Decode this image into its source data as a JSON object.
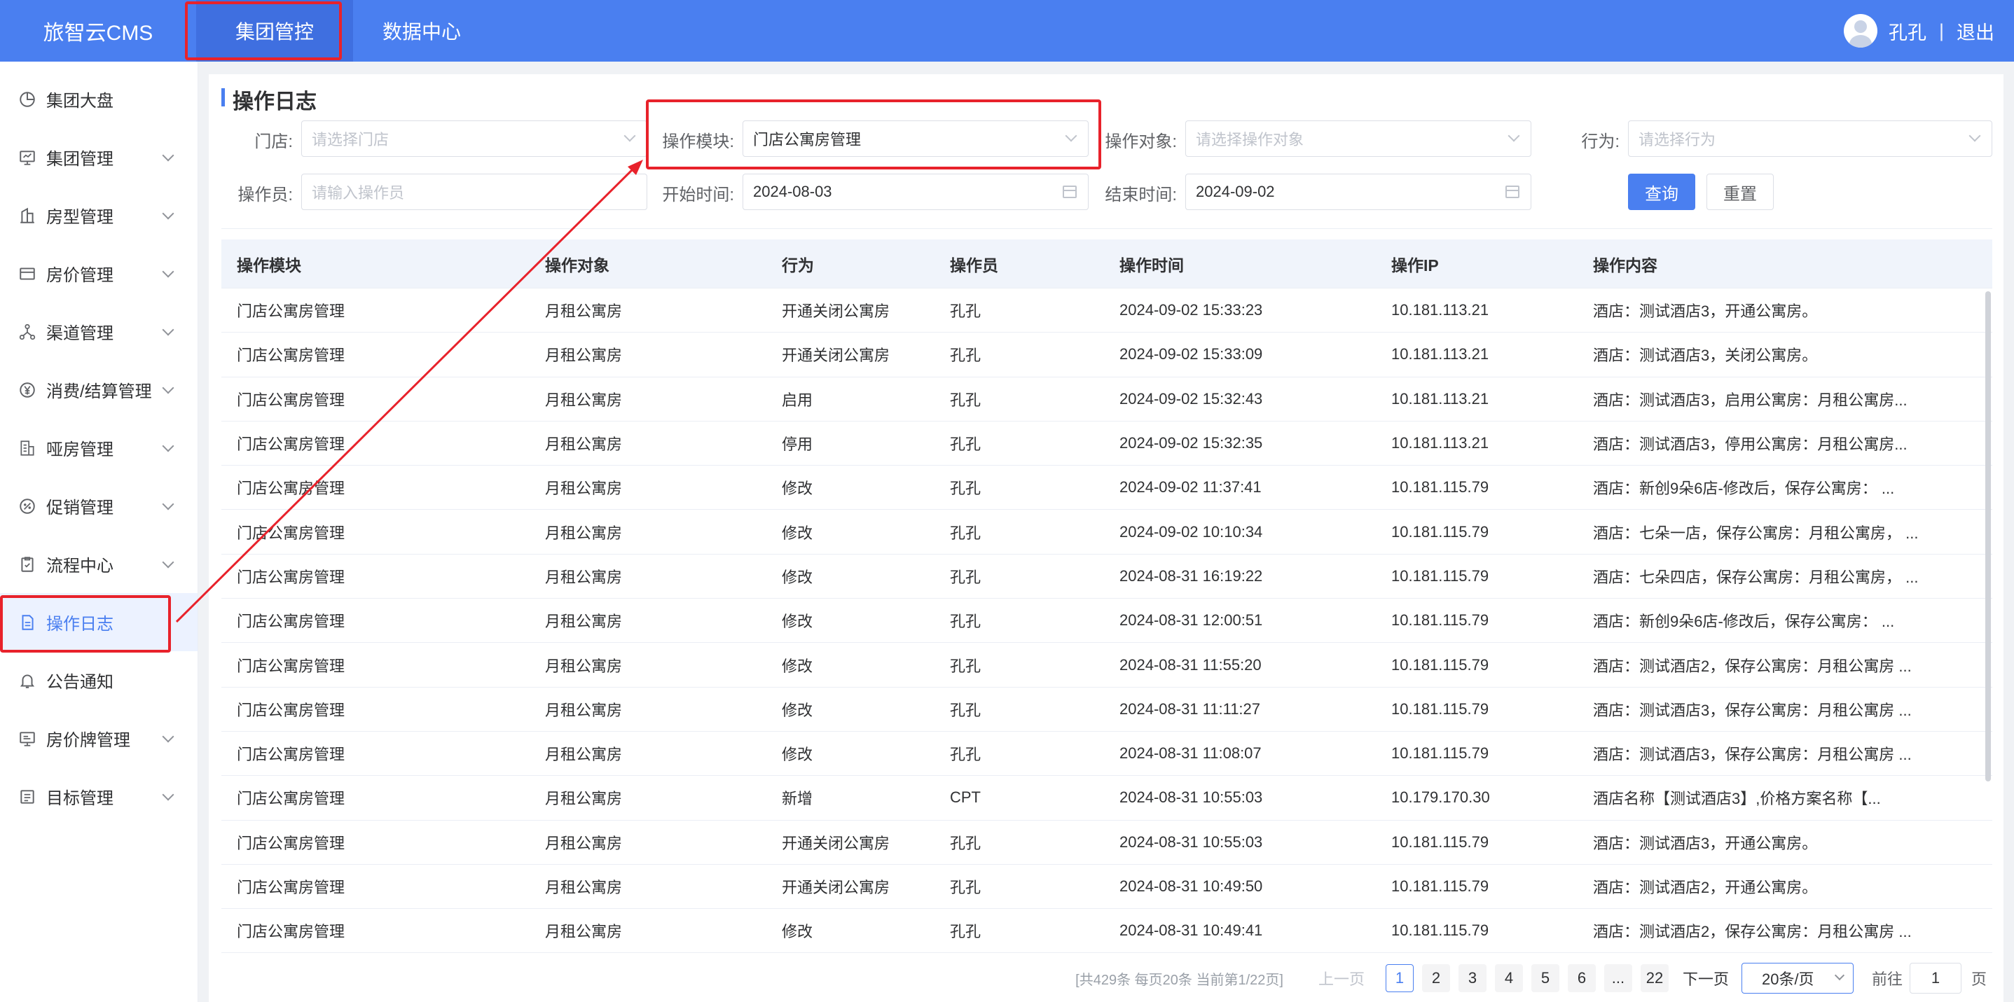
{
  "header": {
    "brand": "旅智云CMS",
    "nav": [
      "集团管控",
      "数据中心"
    ],
    "user": "孔孔",
    "separator": "|",
    "logout": "退出"
  },
  "sidebar": {
    "items": [
      {
        "label": "集团大盘",
        "icon": "pie-chart-icon"
      },
      {
        "label": "集团管理",
        "icon": "monitor-icon"
      },
      {
        "label": "房型管理",
        "icon": "building-icon"
      },
      {
        "label": "房价管理",
        "icon": "card-icon"
      },
      {
        "label": "渠道管理",
        "icon": "network-icon"
      },
      {
        "label": "消费/结算管理",
        "icon": "yen-icon"
      },
      {
        "label": "哑房管理",
        "icon": "room-icon"
      },
      {
        "label": "促销管理",
        "icon": "promotion-icon"
      },
      {
        "label": "流程中心",
        "icon": "clipboard-icon"
      },
      {
        "label": "操作日志",
        "icon": "document-icon"
      },
      {
        "label": "公告通知",
        "icon": "bell-icon"
      },
      {
        "label": "房价牌管理",
        "icon": "board-icon"
      },
      {
        "label": "目标管理",
        "icon": "target-icon"
      }
    ]
  },
  "page": {
    "title": "操作日志"
  },
  "filters": {
    "store_label": "门店:",
    "store_placeholder": "请选择门店",
    "module_label": "操作模块:",
    "module_value": "门店公寓房管理",
    "object_label": "操作对象:",
    "object_placeholder": "请选择操作对象",
    "action_label": "行为:",
    "action_placeholder": "请选择行为",
    "operator_label": "操作员:",
    "operator_placeholder": "请输入操作员",
    "start_label": "开始时间:",
    "start_value": "2024-08-03",
    "end_label": "结束时间:",
    "end_value": "2024-09-02",
    "search_button": "查询",
    "reset_button": "重置"
  },
  "table": {
    "columns": [
      "操作模块",
      "操作对象",
      "行为",
      "操作员",
      "操作时间",
      "操作IP",
      "操作内容"
    ],
    "rows": [
      [
        "门店公寓房管理",
        "月租公寓房",
        "开通关闭公寓房",
        "孔孔",
        "2024-09-02 15:33:23",
        "10.181.113.21",
        "酒店：测试酒店3，开通公寓房。"
      ],
      [
        "门店公寓房管理",
        "月租公寓房",
        "开通关闭公寓房",
        "孔孔",
        "2024-09-02 15:33:09",
        "10.181.113.21",
        "酒店：测试酒店3，关闭公寓房。"
      ],
      [
        "门店公寓房管理",
        "月租公寓房",
        "启用",
        "孔孔",
        "2024-09-02 15:32:43",
        "10.181.113.21",
        "酒店：测试酒店3，启用公寓房：月租公寓房..."
      ],
      [
        "门店公寓房管理",
        "月租公寓房",
        "停用",
        "孔孔",
        "2024-09-02 15:32:35",
        "10.181.113.21",
        "酒店：测试酒店3，停用公寓房：月租公寓房..."
      ],
      [
        "门店公寓房管理",
        "月租公寓房",
        "修改",
        "孔孔",
        "2024-09-02 11:37:41",
        "10.181.115.79",
        "酒店：新创9朵6店-修改后，保存公寓房： ..."
      ],
      [
        "门店公寓房管理",
        "月租公寓房",
        "修改",
        "孔孔",
        "2024-09-02 10:10:34",
        "10.181.115.79",
        "酒店：七朵一店，保存公寓房：月租公寓房， ..."
      ],
      [
        "门店公寓房管理",
        "月租公寓房",
        "修改",
        "孔孔",
        "2024-08-31 16:19:22",
        "10.181.115.79",
        "酒店：七朵四店，保存公寓房：月租公寓房， ..."
      ],
      [
        "门店公寓房管理",
        "月租公寓房",
        "修改",
        "孔孔",
        "2024-08-31 12:00:51",
        "10.181.115.79",
        "酒店：新创9朵6店-修改后，保存公寓房： ..."
      ],
      [
        "门店公寓房管理",
        "月租公寓房",
        "修改",
        "孔孔",
        "2024-08-31 11:55:20",
        "10.181.115.79",
        "酒店：测试酒店2，保存公寓房：月租公寓房 ..."
      ],
      [
        "门店公寓房管理",
        "月租公寓房",
        "修改",
        "孔孔",
        "2024-08-31 11:11:27",
        "10.181.115.79",
        "酒店：测试酒店3，保存公寓房：月租公寓房 ..."
      ],
      [
        "门店公寓房管理",
        "月租公寓房",
        "修改",
        "孔孔",
        "2024-08-31 11:08:07",
        "10.181.115.79",
        "酒店：测试酒店3，保存公寓房：月租公寓房 ..."
      ],
      [
        "门店公寓房管理",
        "月租公寓房",
        "新增",
        "CPT",
        "2024-08-31 10:55:03",
        "10.179.170.30",
        "酒店名称【测试酒店3】,价格方案名称【..."
      ],
      [
        "门店公寓房管理",
        "月租公寓房",
        "开通关闭公寓房",
        "孔孔",
        "2024-08-31 10:55:03",
        "10.181.115.79",
        "酒店：测试酒店3，开通公寓房。"
      ],
      [
        "门店公寓房管理",
        "月租公寓房",
        "开通关闭公寓房",
        "孔孔",
        "2024-08-31 10:49:50",
        "10.181.115.79",
        "酒店：测试酒店2，开通公寓房。"
      ],
      [
        "门店公寓房管理",
        "月租公寓房",
        "修改",
        "孔孔",
        "2024-08-31 10:49:41",
        "10.181.115.79",
        "酒店：测试酒店2，保存公寓房：月租公寓房 ..."
      ]
    ]
  },
  "pagination": {
    "info": "[共429条 每页20条 当前第1/22页]",
    "prev": "上一页",
    "pages": [
      "1",
      "2",
      "3",
      "4",
      "5",
      "6",
      "...",
      "22"
    ],
    "current": "1",
    "next": "下一页",
    "page_size": "20条/页",
    "goto_label": "前往",
    "goto_value": "1",
    "page_unit": "页"
  },
  "colors": {
    "primary": "#4a7ff0",
    "annotation_red": "#e8222b"
  }
}
